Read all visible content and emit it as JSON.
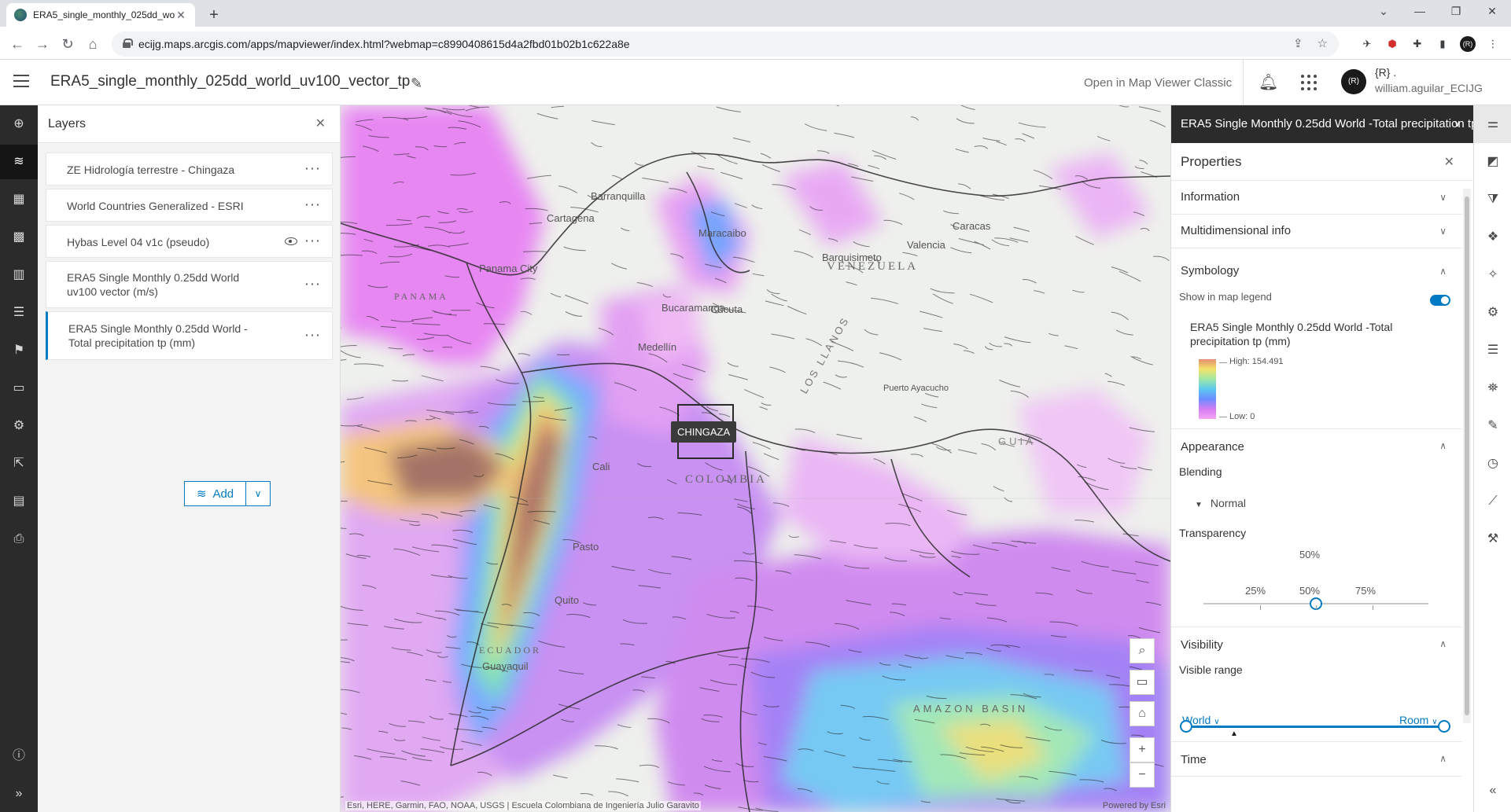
{
  "browser": {
    "tab_title": "ERA5_single_monthly_025dd_wo",
    "url": "ecijg.maps.arcgis.com/apps/mapviewer/index.html?webmap=c8990408615d4a2fbd01b02b1c622a8e"
  },
  "header": {
    "map_title": "ERA5_single_monthly_025dd_world_uv100_vector_tp",
    "classic_link": "Open in Map Viewer Classic",
    "avatar_initials": "(R)",
    "user_name": "{R} .",
    "user_handle": "william.aguilar_ECIJG"
  },
  "layers": {
    "title": "Layers",
    "items": [
      {
        "name": "ZE Hidrología terrestre - Chingaza"
      },
      {
        "name": "World Countries Generalized - ESRI"
      },
      {
        "name": "Hybas Level 04 v1c (pseudo)"
      },
      {
        "line1": "ERA5 Single Monthly 0.25dd World",
        "line2": "uv100 vector (m/s)"
      },
      {
        "line1": "ERA5 Single Monthly 0.25dd World -",
        "line2": "Total precipitation tp (mm)"
      }
    ],
    "add_label": "Add"
  },
  "map": {
    "labels": {
      "venezuela": "VENEZUELA",
      "colombia": "COLOMBIA",
      "panama": "PANAMA",
      "ecuador": "ECUADOR",
      "maracaibo": "Maracaibo",
      "caracas": "Caracas",
      "valencia": "Valencia",
      "barquisimeto": "Barquisimeto",
      "medellin": "Medellín",
      "bucaramanga": "Bucaramanga",
      "cucuta": "Cúcuta",
      "cali": "Cali",
      "quito": "Quito",
      "guayaquil": "Guayaquil",
      "pasto": "Pasto",
      "barranquilla": "Barranquilla",
      "cartagena": "Cartagena",
      "panama_city": "Panama City",
      "puerto_ayacucho": "Puerto Ayacucho",
      "amazon": "AMAZON BASIN",
      "llanos": "LOS LLANOS",
      "guiana": "GUIA"
    },
    "popup": "CHINGAZA",
    "attribution": "Esri, HERE, Garmin, FAO, NOAA, USGS | Escuela Colombiana de Ingeniería Julio Garavito",
    "powered_by": "Powered by Esri"
  },
  "properties": {
    "layer_header": "ERA5 Single Monthly 0.25dd World -Total precipitation tp (mm)",
    "title": "Properties",
    "information": "Information",
    "multidimensional": "Multidimensional info",
    "symbology": "Symbology",
    "show_legend": "Show in map legend",
    "show_legend_on": true,
    "legend_line1": "ERA5 Single Monthly 0.25dd World -Total",
    "legend_line2": "precipitation tp (mm)",
    "legend_high": "High: 154.491",
    "legend_low": "Low: 0",
    "appearance": "Appearance",
    "blending": "Blending",
    "blending_value": "Normal",
    "transparency": "Transparency",
    "transparency_value": "50%",
    "transparency_fraction": 0.5,
    "tick_25": "25%",
    "tick_50": "50%",
    "tick_75": "75%",
    "visibility": "Visibility",
    "visible_range": "Visible range",
    "range_min": "World",
    "range_max": "Room",
    "time": "Time"
  },
  "colors": {
    "accent": "#007ac2",
    "dark_toolbar": "#2b2b2b"
  }
}
